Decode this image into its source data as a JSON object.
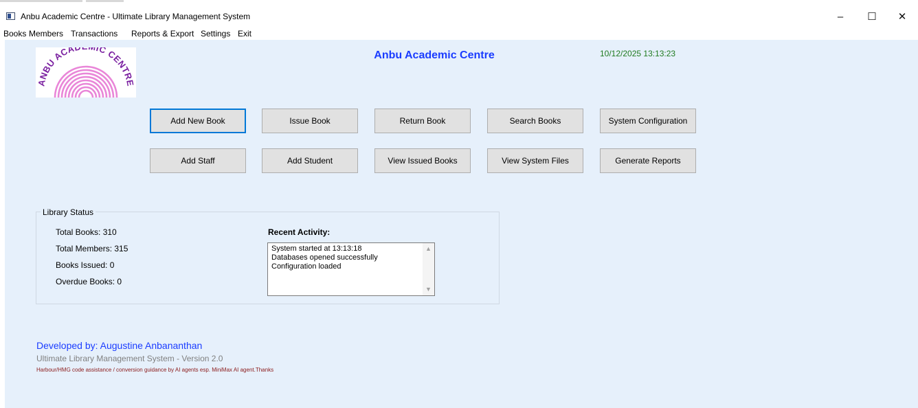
{
  "window": {
    "title": "Anbu Academic Centre - Ultimate Library Management System",
    "controls": {
      "minimize": "–",
      "maximize": "☐",
      "close": "✕"
    }
  },
  "menu": [
    "Books",
    "Members",
    "Transactions",
    "Reports & Export",
    "Settings",
    "Exit"
  ],
  "header": {
    "title": "Anbu Academic Centre",
    "datetime": "10/12/2025 13:13:23",
    "logo_text": "ANBU ACADEMIC CENTRE"
  },
  "buttons": {
    "row1": [
      "Add New Book",
      "Issue Book",
      "Return Book",
      "Search Books",
      "System Configuration"
    ],
    "row2": [
      "Add Staff",
      "Add Student",
      "View Issued Books",
      "View System Files",
      "Generate Reports"
    ]
  },
  "library_status": {
    "label": "Library Status",
    "total_books": "Total Books: 310",
    "total_members": "Total Members: 315",
    "books_issued": "Books Issued: 0",
    "overdue_books": "Overdue Books: 0",
    "recent_label": "Recent Activity:",
    "activity": [
      "System started at 13:13:18",
      "Databases opened successfully",
      "Configuration loaded"
    ]
  },
  "footer": {
    "developer": "Developed by: Augustine Anbananthan",
    "version": "Ultimate Library Management System - Version 2.0",
    "credit": "Harbour/HMG code assistance / conversion guidance by AI agents esp. MiniMax AI agent.Thanks"
  },
  "colors": {
    "client_bg": "#e6f0fb",
    "title_blue": "#1a3cff",
    "datetime_green": "#1f7a1f",
    "logo_pink": "#e986d8",
    "logo_text": "#7a1fa0"
  }
}
